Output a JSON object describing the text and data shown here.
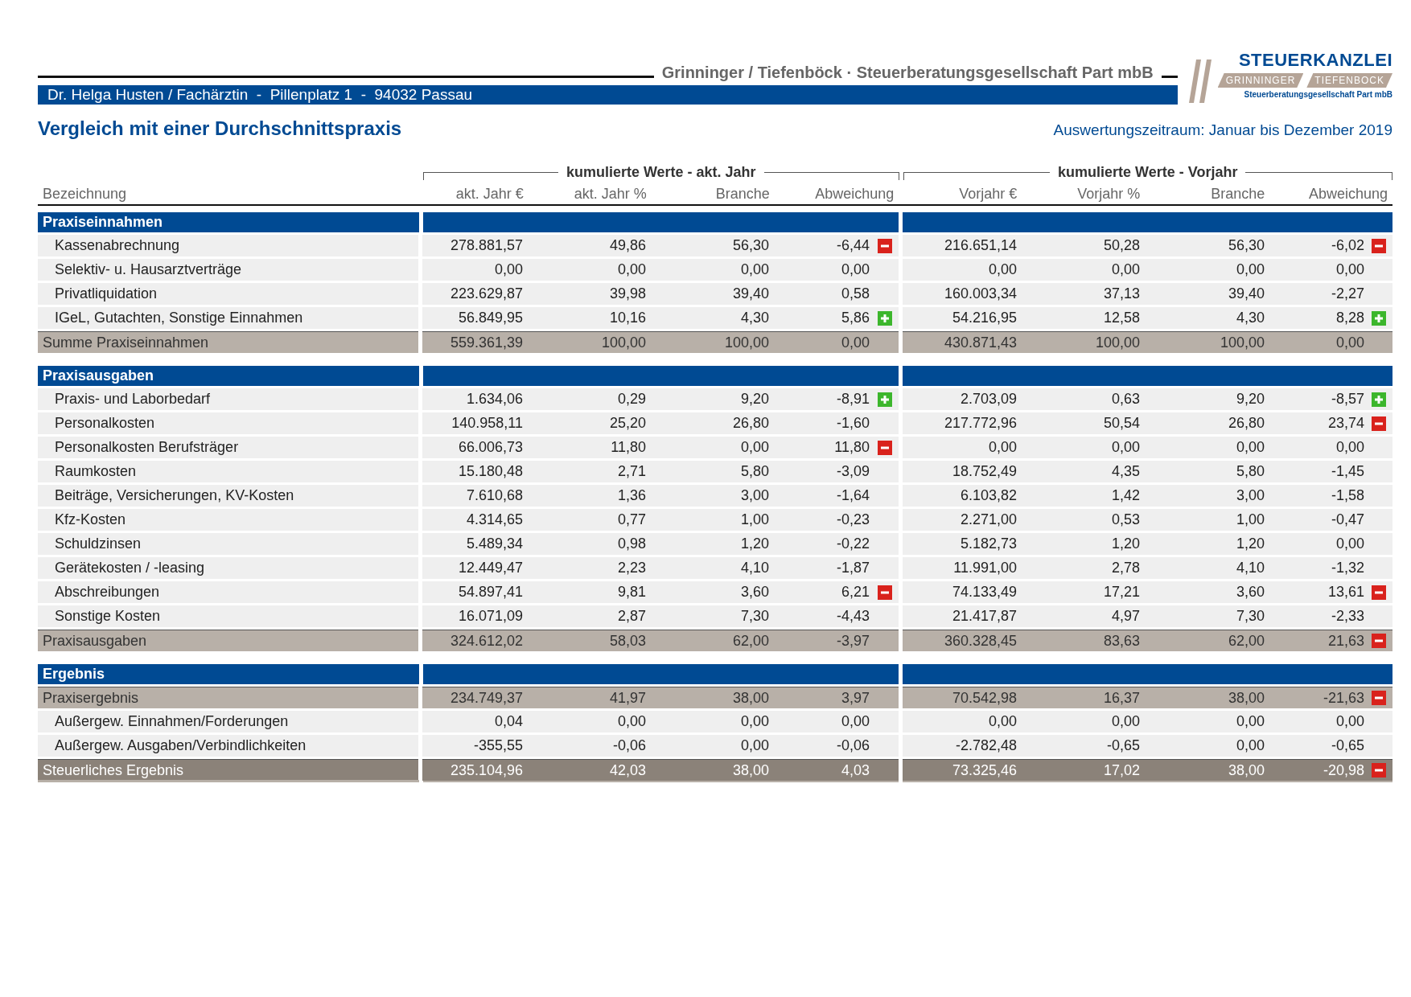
{
  "header": {
    "firm": "Grinninger / Tiefenböck · Steuerberatungsgesellschaft Part mbB",
    "client": "Dr. Helga Husten / Fachärztin  -  Pillenplatz 1  -  94032 Passau"
  },
  "logo": {
    "title": "STEUERKANZLEI",
    "left": "GRINNINGER",
    "right": "TIEFENBOCK",
    "subtitle": "Steuerberatungsgesellschaft Part mbB"
  },
  "title": "Vergleich mit einer Durchschnittspraxis",
  "period": "Auswertungszeitraum: Januar bis Dezember 2019",
  "groups": [
    "kumulierte Werte - akt. Jahr",
    "kumulierte Werte - Vorjahr"
  ],
  "columns": {
    "label": "Bezeichnung",
    "cur": [
      "akt. Jahr €",
      "akt. Jahr %",
      "Branche",
      "Abweichung"
    ],
    "prev": [
      "Vorjahr €",
      "Vorjahr %",
      "Branche",
      "Abweichung"
    ]
  },
  "sections": [
    {
      "title": "Praxiseinnahmen",
      "rows": [
        {
          "kind": "item",
          "label": "Kassenabrechnung",
          "cur": [
            "278.881,57",
            "49,86",
            "56,30",
            "-6,44"
          ],
          "prev": [
            "216.651,14",
            "50,28",
            "56,30",
            "-6,02"
          ],
          "cur_flag": {
            "kind": "minus"
          },
          "prev_flag": {
            "kind": "minus"
          }
        },
        {
          "kind": "item",
          "label": "Selektiv- u. Hausarztverträge",
          "cur": [
            "0,00",
            "0,00",
            "0,00",
            "0,00"
          ],
          "prev": [
            "0,00",
            "0,00",
            "0,00",
            "0,00"
          ]
        },
        {
          "kind": "item",
          "label": "Privatliquidation",
          "cur": [
            "223.629,87",
            "39,98",
            "39,40",
            "0,58"
          ],
          "prev": [
            "160.003,34",
            "37,13",
            "39,40",
            "-2,27"
          ]
        },
        {
          "kind": "item",
          "label": "IGeL, Gutachten, Sonstige Einnahmen",
          "cur": [
            "56.849,95",
            "10,16",
            "4,30",
            "5,86"
          ],
          "prev": [
            "54.216,95",
            "12,58",
            "4,30",
            "8,28"
          ],
          "cur_flag": {
            "kind": "plus"
          },
          "prev_flag": {
            "kind": "plus"
          }
        },
        {
          "kind": "subtotal",
          "label": "Summe Praxiseinnahmen",
          "cur": [
            "559.361,39",
            "100,00",
            "100,00",
            "0,00"
          ],
          "prev": [
            "430.871,43",
            "100,00",
            "100,00",
            "0,00"
          ]
        }
      ]
    },
    {
      "title": "Praxisausgaben",
      "rows": [
        {
          "kind": "item",
          "label": "Praxis- und Laborbedarf",
          "cur": [
            "1.634,06",
            "0,29",
            "9,20",
            "-8,91"
          ],
          "prev": [
            "2.703,09",
            "0,63",
            "9,20",
            "-8,57"
          ],
          "cur_flag": {
            "kind": "plus"
          },
          "prev_flag": {
            "kind": "plus"
          }
        },
        {
          "kind": "item",
          "label": "Personalkosten",
          "cur": [
            "140.958,11",
            "25,20",
            "26,80",
            "-1,60"
          ],
          "prev": [
            "217.772,96",
            "50,54",
            "26,80",
            "23,74"
          ],
          "prev_flag": {
            "kind": "minus"
          }
        },
        {
          "kind": "item",
          "label": "Personalkosten Berufsträger",
          "cur": [
            "66.006,73",
            "11,80",
            "0,00",
            "11,80"
          ],
          "prev": [
            "0,00",
            "0,00",
            "0,00",
            "0,00"
          ],
          "cur_flag": {
            "kind": "minus"
          }
        },
        {
          "kind": "item",
          "label": "Raumkosten",
          "cur": [
            "15.180,48",
            "2,71",
            "5,80",
            "-3,09"
          ],
          "prev": [
            "18.752,49",
            "4,35",
            "5,80",
            "-1,45"
          ]
        },
        {
          "kind": "item",
          "label": "Beiträge, Versicherungen, KV-Kosten",
          "cur": [
            "7.610,68",
            "1,36",
            "3,00",
            "-1,64"
          ],
          "prev": [
            "6.103,82",
            "1,42",
            "3,00",
            "-1,58"
          ]
        },
        {
          "kind": "item",
          "label": "Kfz-Kosten",
          "cur": [
            "4.314,65",
            "0,77",
            "1,00",
            "-0,23"
          ],
          "prev": [
            "2.271,00",
            "0,53",
            "1,00",
            "-0,47"
          ]
        },
        {
          "kind": "item",
          "label": "Schuldzinsen",
          "cur": [
            "5.489,34",
            "0,98",
            "1,20",
            "-0,22"
          ],
          "prev": [
            "5.182,73",
            "1,20",
            "1,20",
            "0,00"
          ]
        },
        {
          "kind": "item",
          "label": "Gerätekosten / -leasing",
          "cur": [
            "12.449,47",
            "2,23",
            "4,10",
            "-1,87"
          ],
          "prev": [
            "11.991,00",
            "2,78",
            "4,10",
            "-1,32"
          ]
        },
        {
          "kind": "item",
          "label": "Abschreibungen",
          "cur": [
            "54.897,41",
            "9,81",
            "3,60",
            "6,21"
          ],
          "prev": [
            "74.133,49",
            "17,21",
            "3,60",
            "13,61"
          ],
          "cur_flag": {
            "kind": "minus"
          },
          "prev_flag": {
            "kind": "minus"
          }
        },
        {
          "kind": "item",
          "label": "Sonstige Kosten",
          "cur": [
            "16.071,09",
            "2,87",
            "7,30",
            "-4,43"
          ],
          "prev": [
            "21.417,87",
            "4,97",
            "7,30",
            "-2,33"
          ]
        },
        {
          "kind": "subtotal",
          "label": "Praxisausgaben",
          "cur": [
            "324.612,02",
            "58,03",
            "62,00",
            "-3,97"
          ],
          "prev": [
            "360.328,45",
            "83,63",
            "62,00",
            "21,63"
          ],
          "prev_flag": {
            "kind": "minus"
          }
        }
      ]
    },
    {
      "title": "Ergebnis",
      "rows": [
        {
          "kind": "subtotal",
          "label": "Praxisergebnis",
          "cur": [
            "234.749,37",
            "41,97",
            "38,00",
            "3,97"
          ],
          "prev": [
            "70.542,98",
            "16,37",
            "38,00",
            "-21,63"
          ],
          "prev_flag": {
            "kind": "minus"
          }
        },
        {
          "kind": "item",
          "label": "Außergew. Einnahmen/Forderungen",
          "cur": [
            "0,04",
            "0,00",
            "0,00",
            "0,00"
          ],
          "prev": [
            "0,00",
            "0,00",
            "0,00",
            "0,00"
          ]
        },
        {
          "kind": "item",
          "label": "Außergew. Ausgaben/Verbindlichkeiten",
          "cur": [
            "-355,55",
            "-0,06",
            "0,00",
            "-0,06"
          ],
          "prev": [
            "-2.782,48",
            "-0,65",
            "0,00",
            "-0,65"
          ]
        },
        {
          "kind": "total",
          "label": "Steuerliches Ergebnis",
          "cur": [
            "235.104,96",
            "42,03",
            "38,00",
            "4,03"
          ],
          "prev": [
            "73.325,46",
            "17,02",
            "38,00",
            "-20,98"
          ],
          "prev_flag": {
            "kind": "minus"
          }
        }
      ]
    }
  ]
}
